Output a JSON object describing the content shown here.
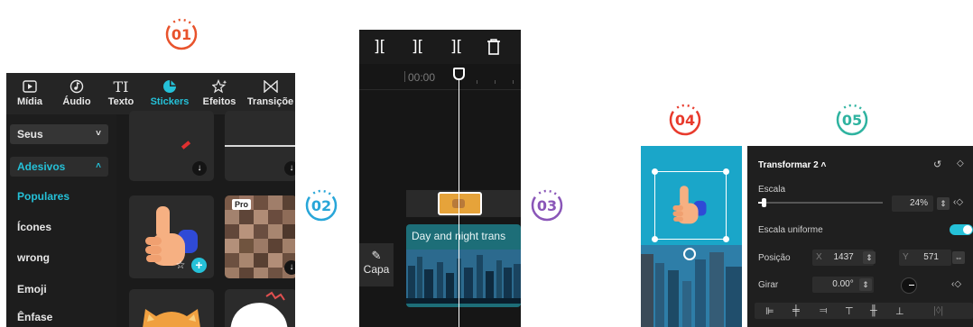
{
  "badges": [
    {
      "label": "01",
      "color": "#e8532c",
      "accent": "#f0a830"
    },
    {
      "label": "02",
      "color": "#28a6d8",
      "accent": "#6fd0e8"
    },
    {
      "label": "03",
      "color": "#8a56b8",
      "accent": "#c39ad8"
    },
    {
      "label": "04",
      "color": "#e83a2c",
      "accent": "#f07a40"
    },
    {
      "label": "05",
      "color": "#2fb3a0",
      "accent": "#8cd88a"
    }
  ],
  "panel1": {
    "tabs": [
      {
        "label": "Mídia",
        "icon": "media-play-icon"
      },
      {
        "label": "Áudio",
        "icon": "music-note-icon"
      },
      {
        "label": "Texto",
        "icon": "text-icon"
      },
      {
        "label": "Stickers",
        "icon": "sticker-icon"
      },
      {
        "label": "Efeitos",
        "icon": "sparkle-star-icon"
      },
      {
        "label": "Transiçõe",
        "icon": "bowtie-transition-icon"
      }
    ],
    "sidebar": [
      {
        "label": "Seus",
        "chevron": "˅"
      },
      {
        "label": "Adesivos",
        "chevron": "˄"
      },
      {
        "label": "Populares"
      },
      {
        "label": "Ícones"
      },
      {
        "label": "wrong"
      },
      {
        "label": "Emoji"
      },
      {
        "label": "Ênfase"
      }
    ],
    "pro_label": "Pro",
    "accent": "#25c1d8"
  },
  "panel2": {
    "timecode": "00:00",
    "clip_label": "Day and night trans",
    "cover_label": "Capa"
  },
  "panel5": {
    "title": "Transformar 2 ˄",
    "scale_label": "Escala",
    "scale_value": "24%",
    "uniform_label": "Escala uniforme",
    "position_label": "Posição",
    "pos_x_label": "X",
    "pos_x_value": "1437",
    "pos_y_label": "Y",
    "pos_y_value": "571",
    "rotate_label": "Girar",
    "rotate_value": "0.00°"
  }
}
